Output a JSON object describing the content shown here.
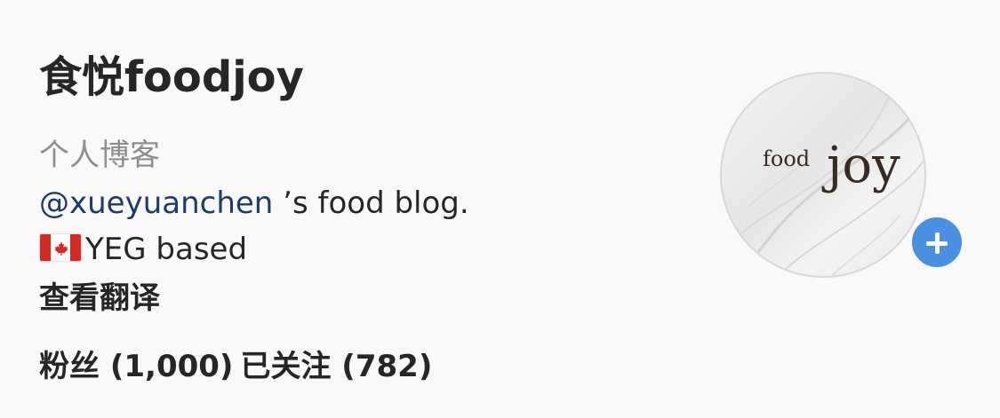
{
  "profile": {
    "name": "食悦foodjoy",
    "category": "个人博客",
    "bio": {
      "mention": "@xueyuanchen",
      "line1_rest": " ’s food blog.",
      "line2_text": "YEG based"
    },
    "translate_label": "查看翻译",
    "stats": {
      "followers": "粉丝 (1,000)",
      "following": "已关注 (782)"
    },
    "avatar": {
      "logo_small": "food",
      "logo_large": "joy"
    }
  },
  "icons": {
    "flag": "canada-flag-icon",
    "add": "plus-icon"
  },
  "colors": {
    "mention": "#1c3d69",
    "badge": "#4a90e2",
    "muted": "#8e8e8e",
    "flag_red": "#d52b1e"
  }
}
